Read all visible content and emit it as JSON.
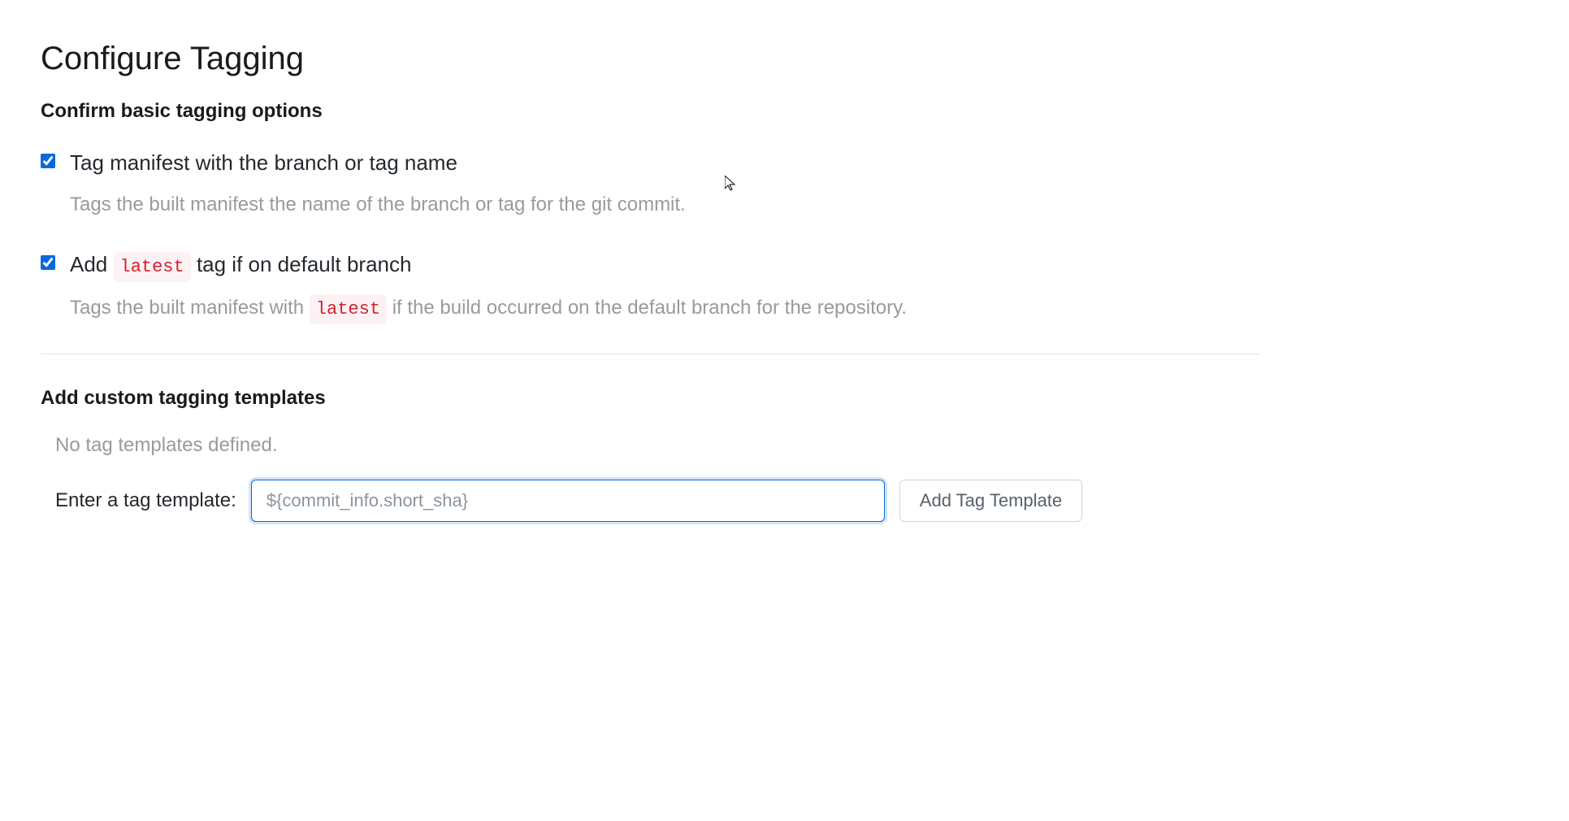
{
  "page": {
    "title": "Configure Tagging",
    "section_basic": "Confirm basic tagging options",
    "section_custom": "Add custom tagging templates"
  },
  "options": {
    "branch_tag": {
      "checked": true,
      "label": "Tag manifest with the branch or tag name",
      "desc": "Tags the built manifest the name of the branch or tag for the git commit."
    },
    "latest_tag": {
      "checked": true,
      "label_pre": "Add ",
      "code": "latest",
      "label_post": " tag if on default branch",
      "desc_pre": "Tags the built manifest with ",
      "desc_code": "latest",
      "desc_post": " if the build occurred on the default branch for the repository."
    }
  },
  "custom": {
    "empty_text": "No tag templates defined.",
    "input_label": "Enter a tag template:",
    "input_placeholder": "${commit_info.short_sha}",
    "add_button": "Add Tag Template"
  }
}
